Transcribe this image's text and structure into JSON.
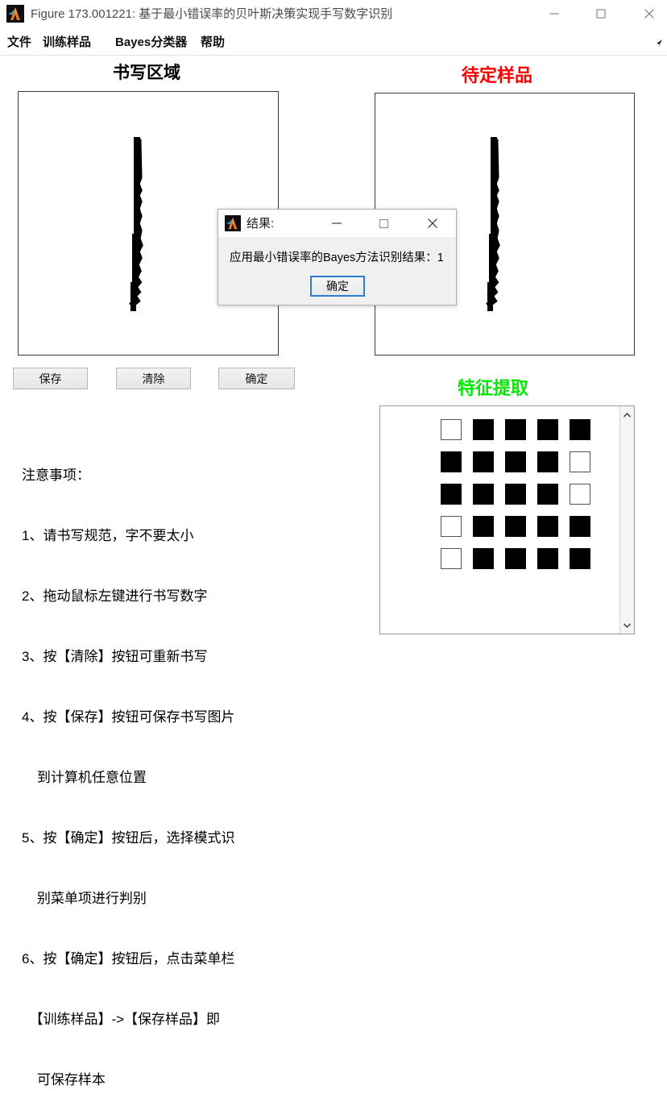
{
  "window": {
    "title": "Figure 173.001221: 基于最小错误率的贝叶斯决策实现手写数字识别",
    "icon": "matlab-icon",
    "controls": {
      "minimize": "minimize-icon",
      "maximize": "maximize-icon",
      "close": "close-icon"
    }
  },
  "menubar": {
    "items": [
      {
        "label": "文件"
      },
      {
        "label": "训练样品"
      },
      {
        "label": "Bayes分类器"
      },
      {
        "label": "帮助"
      }
    ]
  },
  "headings": {
    "write_area": "书写区域",
    "pending_sample": "待定样品",
    "feature_extraction": "特征提取"
  },
  "colors": {
    "write_area": "#000000",
    "pending_sample": "#ff0000",
    "feature_extraction": "#00e800",
    "dialog_focus": "#2a7fd4"
  },
  "buttons": {
    "save": "保存",
    "clear": "清除",
    "confirm": "确定"
  },
  "notes": {
    "title": "注意事项：",
    "lines": [
      "1、请书写规范，字不要太小",
      "2、拖动鼠标左键进行书写数字",
      "3、按【清除】按钮可重新书写",
      "4、按【保存】按钮可保存书写图片",
      "    到计算机任意位置",
      "5、按【确定】按钮后，选择模式识",
      "    别菜单项进行判别",
      "6、按【确定】按钮后，点击菜单栏",
      "  【训练样品】->【保存样品】即",
      "    可保存样本"
    ]
  },
  "feature_panel": {
    "grid_rows": 5,
    "grid_cols": 5,
    "grid": [
      [
        0,
        1,
        1,
        1,
        1
      ],
      [
        1,
        1,
        1,
        1,
        0
      ],
      [
        1,
        1,
        1,
        1,
        0
      ],
      [
        0,
        1,
        1,
        1,
        1
      ],
      [
        0,
        1,
        1,
        1,
        1
      ]
    ],
    "scrollbar": {
      "up": "chevron-up-icon",
      "down": "chevron-down-icon"
    }
  },
  "dialog": {
    "title": "结果:",
    "icon": "matlab-icon",
    "message": "应用最小错误率的Bayes方法识别结果：1",
    "ok_label": "确定",
    "controls": {
      "minimize": "minimize-icon",
      "maximize": "maximize-icon",
      "close": "close-icon"
    }
  },
  "canvas": {
    "left_digit": "1",
    "right_digit": "1"
  }
}
